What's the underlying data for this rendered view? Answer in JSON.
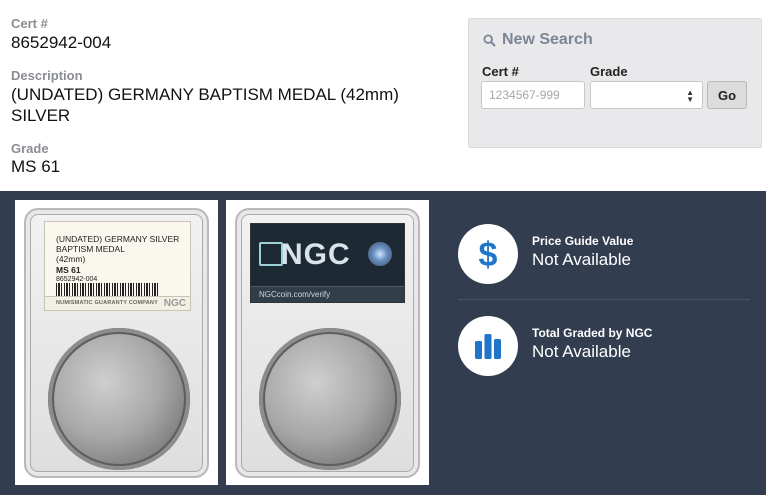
{
  "details": {
    "cert_label": "Cert #",
    "cert_value": "8652942-004",
    "description_label": "Description",
    "description_value": "(UNDATED) GERMANY BAPTISM MEDAL (42mm) SILVER",
    "grade_label": "Grade",
    "grade_value": "MS 61"
  },
  "search": {
    "title": "New Search",
    "cert_label": "Cert #",
    "cert_placeholder": "1234567-999",
    "grade_label": "Grade",
    "grade_selected": "",
    "go_label": "Go"
  },
  "slab_front_label": {
    "line1": "(UNDATED) GERMANY SILVER",
    "line2": "BAPTISM MEDAL",
    "line3": "(42mm)",
    "line4": "MS 61",
    "line5": "8652942-004",
    "footer": "NUMISMATIC GUARANTY COMPANY",
    "footer_logo": "NGC"
  },
  "slab_back_label": {
    "logo": "NGC",
    "verify": "NGCcoin.com/verify"
  },
  "stats": [
    {
      "label": "Price Guide Value",
      "value": "Not Available",
      "icon": "dollar-icon"
    },
    {
      "label": "Total Graded by NGC",
      "value": "Not Available",
      "icon": "bar-chart-icon"
    }
  ],
  "colors": {
    "band": "#333d50",
    "accent_blue": "#1f76c8",
    "label_gray": "#8a8d92"
  }
}
